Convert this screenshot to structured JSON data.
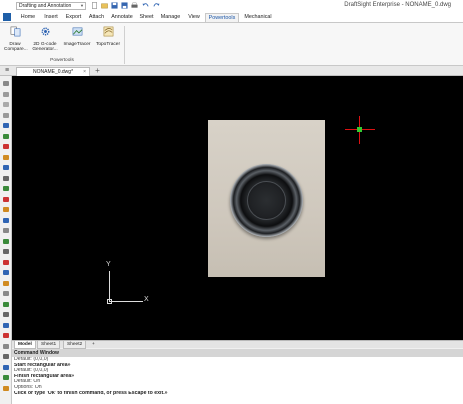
{
  "workspace": {
    "selected": "Drafting and Annotation"
  },
  "app_title": "DraftSight Enterprise - NONAME_0.dwg",
  "ribbon_tabs": [
    "Home",
    "Insert",
    "Export",
    "Attach",
    "Annotate",
    "Sheet",
    "Manage",
    "View",
    "Powertools",
    "Mechanical"
  ],
  "active_tab": "Powertools",
  "ribbon": {
    "buttons": [
      {
        "line1": "Draw",
        "line2": "Compare..."
      },
      {
        "line1": "2D G-code",
        "line2": "Generator..."
      },
      {
        "line1": "ImageTracer",
        "line2": ""
      },
      {
        "line1": "TopoTracer",
        "line2": ""
      }
    ],
    "group_label": "Powertools"
  },
  "document_tab": {
    "label": "NONAME_0.dwg*",
    "close": "×",
    "add": "+"
  },
  "layout_tabs": [
    "Model",
    "Sheet1",
    "Sheet2"
  ],
  "layout_add": "+",
  "ucs": {
    "x": "X",
    "y": "Y"
  },
  "command_window": {
    "title": "Command Window",
    "lines": [
      {
        "text": "Default: (0,0,0)",
        "bold": false
      },
      {
        "text": "Start rectangular area»",
        "bold": true
      },
      {
        "text": "Default: (0,0,0)",
        "bold": false
      },
      {
        "text": "Finish rectangular area»",
        "bold": true
      },
      {
        "text": "Default: On",
        "bold": false
      },
      {
        "text": "Options: On",
        "bold": false
      },
      {
        "text": "Click or type 'Ok' to finish command, or press Escape to exit.»",
        "bold": true
      }
    ]
  },
  "colors": {
    "accent": "#1a56a8",
    "canvas": "#000000",
    "crosshair": "#dd1111",
    "crosshair_center": "#33cc33"
  }
}
